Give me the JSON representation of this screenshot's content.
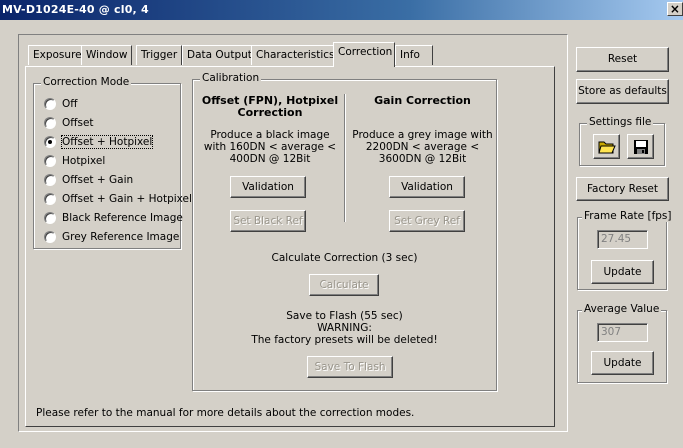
{
  "window": {
    "title": "MV-D1024E-40 @ cl0, 4",
    "close_label": "×"
  },
  "tabs": [
    {
      "label": "Exposure"
    },
    {
      "label": "Window"
    },
    {
      "label": "Trigger"
    },
    {
      "label": "Data Output"
    },
    {
      "label": "Characteristics"
    },
    {
      "label": "Correction",
      "active": true
    },
    {
      "label": "Info"
    }
  ],
  "correction_mode": {
    "legend": "Correction Mode",
    "options": [
      {
        "label": "Off"
      },
      {
        "label": "Offset"
      },
      {
        "label": "Offset + Hotpixel",
        "selected": true
      },
      {
        "label": "Hotpixel"
      },
      {
        "label": "Offset + Gain"
      },
      {
        "label": "Offset + Gain + Hotpixel"
      },
      {
        "label": "Black Reference Image"
      },
      {
        "label": "Grey Reference Image"
      }
    ]
  },
  "calibration": {
    "legend": "Calibration",
    "offset": {
      "heading": "Offset (FPN), Hotpixel Correction",
      "description": "Produce a black image with 160DN < average < 400DN @ 12Bit",
      "validation_label": "Validation",
      "set_ref_label": "Set Black Ref"
    },
    "gain": {
      "heading": "Gain Correction",
      "description": "Produce a grey image with 2200DN < average < 3600DN @ 12Bit",
      "validation_label": "Validation",
      "set_ref_label": "Set Grey Ref"
    },
    "calculate_caption": "Calculate Correction (3 sec)",
    "calculate_label": "Calculate",
    "flash_caption": "Save to Flash (55 sec)",
    "flash_warning_title": "WARNING:",
    "flash_warning_text": "The factory presets will be deleted!",
    "flash_label": "Save To Flash"
  },
  "footer_note": "Please refer to the manual for more details about the correction modes.",
  "side": {
    "reset_label": "Reset",
    "store_defaults_label": "Store as defaults",
    "settings_file_legend": "Settings file",
    "factory_reset_label": "Factory Reset",
    "frame_rate": {
      "legend": "Frame Rate [fps]",
      "value": "27.45",
      "update_label": "Update"
    },
    "average_value": {
      "legend": "Average Value",
      "value": "307",
      "update_label": "Update"
    }
  }
}
